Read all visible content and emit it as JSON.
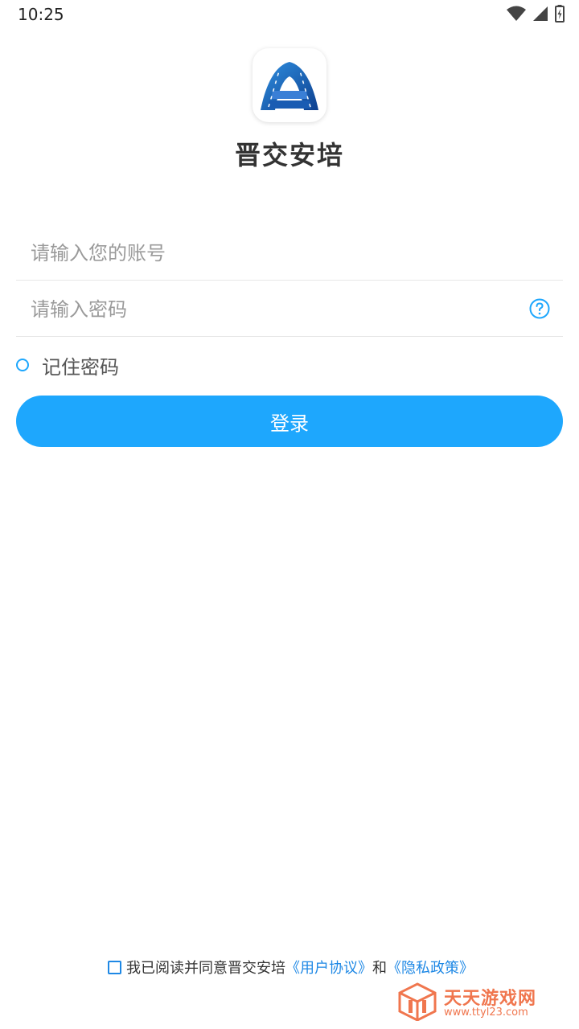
{
  "status_bar": {
    "time": "10:25",
    "icons": [
      "wifi-icon",
      "signal-icon",
      "battery-charging-icon"
    ]
  },
  "app": {
    "name": "晋交安培",
    "logo_icon": "road-bridge-logo-icon"
  },
  "login_form": {
    "account_placeholder": "请输入您的账号",
    "password_placeholder": "请输入密码",
    "help_icon": "question-circle-icon",
    "remember_label": "记住密码",
    "login_label": "登录"
  },
  "agreement": {
    "text": "我已阅读并同意晋交安培",
    "user_agreement": "《用户协议》",
    "and": "和",
    "privacy_policy": "《隐私政策》"
  },
  "watermark": {
    "title": "天天游戏网",
    "url": "www.ttyl23.com"
  },
  "colors": {
    "accent": "#1ea7fd",
    "link": "#1e88e5",
    "watermark": "#f0764e"
  }
}
